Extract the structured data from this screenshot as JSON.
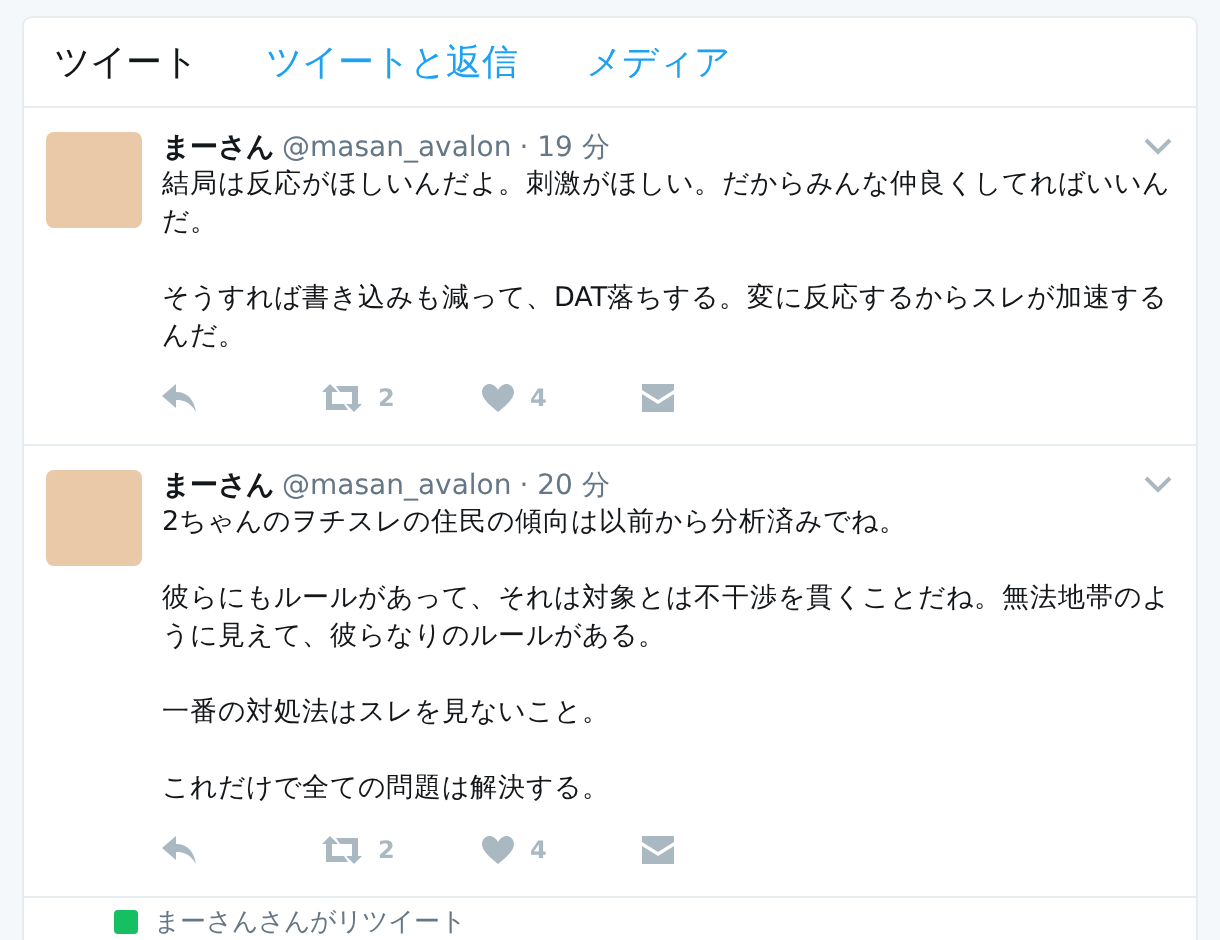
{
  "tabs": [
    {
      "label": "ツイート",
      "selected": true
    },
    {
      "label": "ツイートと返信",
      "selected": false
    },
    {
      "label": "メディア",
      "selected": false
    }
  ],
  "tweets": [
    {
      "name": "まーさん",
      "handle": "@masan_avalon",
      "time": "· 19 分",
      "paragraphs": [
        "結局は反応がほしいんだよ。刺激がほしい。だからみんな仲良くしてればいいんだ。",
        "そうすれば書き込みも減って、DAT落ちする。変に反応するからスレが加速するんだ。"
      ],
      "retweets": "2",
      "likes": "4"
    },
    {
      "name": "まーさん",
      "handle": "@masan_avalon",
      "time": "· 20 分",
      "paragraphs": [
        "2ちゃんのヲチスレの住民の傾向は以前から分析済みでね。",
        "彼らにもルールがあって、それは対象とは不干渉を貫くことだね。無法地帯のように見えて、彼らなりのルールがある。",
        "一番の対処法はスレを見ないこと。",
        "これだけで全ての問題は解決する。"
      ],
      "retweets": "2",
      "likes": "4"
    }
  ],
  "retweet_notice": "まーさんさんがリツイート"
}
